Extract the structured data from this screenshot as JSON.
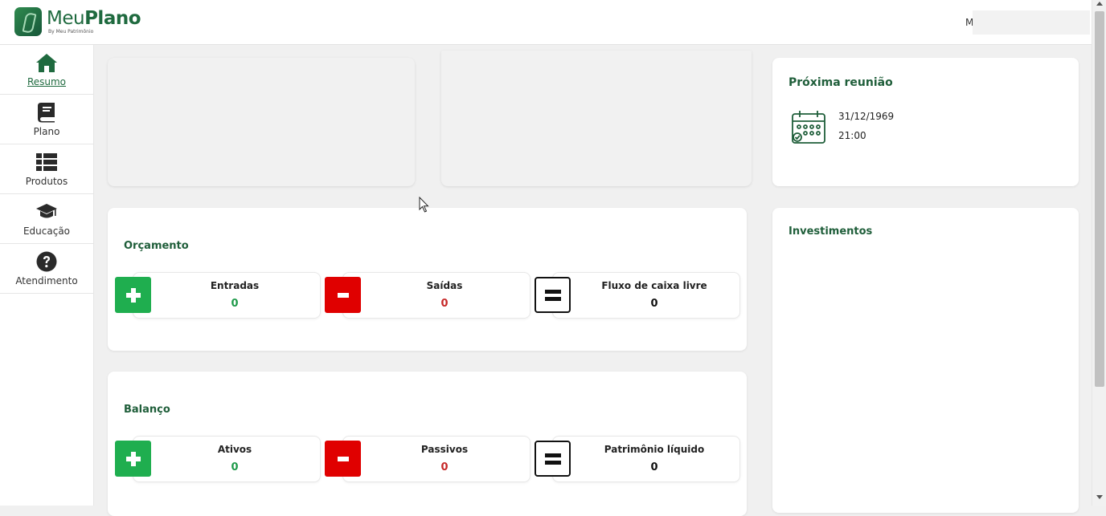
{
  "header": {
    "logo_prefix": "Meu",
    "logo_bold": "Plano",
    "logo_sub": "By Meu Patrimônio",
    "user_initial": "M"
  },
  "sidebar": {
    "items": [
      {
        "label": "Resumo",
        "icon": "home-icon",
        "active": true
      },
      {
        "label": "Plano",
        "icon": "book-icon",
        "active": false
      },
      {
        "label": "Produtos",
        "icon": "list-icon",
        "active": false
      },
      {
        "label": "Educação",
        "icon": "graduation-cap-icon",
        "active": false
      },
      {
        "label": "Atendimento",
        "icon": "help-icon",
        "active": false
      }
    ]
  },
  "meeting": {
    "title": "Próxima reunião",
    "date": "31/12/1969",
    "time": "21:00"
  },
  "investments": {
    "title": "Investimentos"
  },
  "budget": {
    "title": "Orçamento",
    "income": {
      "label": "Entradas",
      "value": "0"
    },
    "expenses": {
      "label": "Saídas",
      "value": "0"
    },
    "cashflow": {
      "label": "Fluxo de caixa livre",
      "value": "0"
    }
  },
  "balance": {
    "title": "Balanço",
    "assets": {
      "label": "Ativos",
      "value": "0"
    },
    "liabilities": {
      "label": "Passivos",
      "value": "0"
    },
    "net_worth": {
      "label": "Patrimônio líquido",
      "value": "0"
    }
  },
  "colors": {
    "brand_green": "#1f6a3f",
    "plus_green": "#1fae4f",
    "minus_red": "#e00000",
    "value_green": "#1f9a4a",
    "value_red": "#c62828"
  }
}
